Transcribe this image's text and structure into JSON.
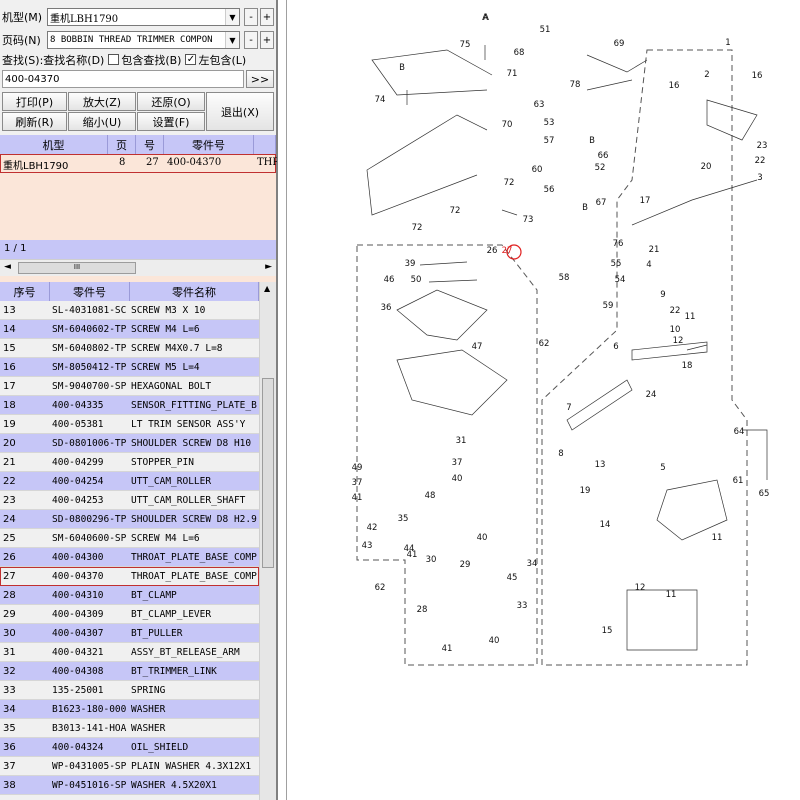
{
  "top": {
    "model_label": "机型(M)",
    "model_value": "重机LBH1790",
    "page_label": "页码(N)",
    "page_value": "8 BOBBIN THREAD TRIMMER COMPON",
    "search_label": "查找(S):",
    "search_name_label": "查找名称(D)",
    "include_search_label": "包含查找(B)",
    "left_include_label": "左包含(L)",
    "include_search_checked": false,
    "left_include_checked": true,
    "search_value": "400-04370",
    "go_label": ">>",
    "minus": "-",
    "plus": "+"
  },
  "buttons": {
    "print": "打印(P)",
    "zoom_in": "放大(Z)",
    "restore": "还原(O)",
    "exit": "退出(X)",
    "refresh": "刷新(R)",
    "zoom_out": "缩小(U)",
    "settings": "设置(F)"
  },
  "result_table": {
    "headers": [
      "机型",
      "页",
      "号",
      "零件号",
      ""
    ],
    "row": [
      "重机LBH1790",
      "8",
      "27",
      "400-04370",
      "THR"
    ],
    "pager": "1 / 1",
    "hscroll_thumb": "III"
  },
  "parts_table": {
    "headers": [
      "序号",
      "零件号",
      "零件名称"
    ],
    "selected_index": 27,
    "rows": [
      [
        "13",
        "SL-4031081-SC",
        "SCREW M3 X 10"
      ],
      [
        "14",
        "SM-6040602-TP",
        "SCREW M4 L=6"
      ],
      [
        "15",
        "SM-6040802-TP",
        "SCREW M4X0.7 L=8"
      ],
      [
        "16",
        "SM-8050412-TP",
        "SCREW M5 L=4"
      ],
      [
        "17",
        "SM-9040700-SP",
        "HEXAGONAL BOLT"
      ],
      [
        "18",
        "400-04335",
        "SENSOR_FITTING_PLATE_B"
      ],
      [
        "19",
        "400-05381",
        "LT TRIM SENSOR ASS'Y"
      ],
      [
        "20",
        "SD-0801006-TP",
        "SHOULDER SCREW D8 H10"
      ],
      [
        "21",
        "400-04299",
        "STOPPER_PIN"
      ],
      [
        "22",
        "400-04254",
        "UTT_CAM_ROLLER"
      ],
      [
        "23",
        "400-04253",
        "UTT_CAM_ROLLER_SHAFT"
      ],
      [
        "24",
        "SD-0800296-TP",
        "SHOULDER SCREW D8 H2.9"
      ],
      [
        "25",
        "SM-6040600-SP",
        "SCREW M4 L=6"
      ],
      [
        "26",
        "400-04300",
        "THROAT_PLATE_BASE_COMP"
      ],
      [
        "27",
        "400-04370",
        "THROAT_PLATE_BASE_COMP"
      ],
      [
        "28",
        "400-04310",
        "BT_CLAMP"
      ],
      [
        "29",
        "400-04309",
        "BT_CLAMP_LEVER"
      ],
      [
        "30",
        "400-04307",
        "BT_PULLER"
      ],
      [
        "31",
        "400-04321",
        "ASSY_BT_RELEASE_ARM"
      ],
      [
        "32",
        "400-04308",
        "BT_TRIMMER_LINK"
      ],
      [
        "33",
        "135-25001",
        "SPRING"
      ],
      [
        "34",
        "B1623-180-000",
        "WASHER"
      ],
      [
        "35",
        "B3013-141-HOA",
        "WASHER"
      ],
      [
        "36",
        "400-04324",
        "OIL_SHIELD"
      ],
      [
        "37",
        "WP-0431005-SP",
        "PLAIN WASHER 4.3X12X1"
      ],
      [
        "38",
        "WP-0451016-SP",
        "WASHER 4.5X20X1"
      ]
    ]
  },
  "diagram": {
    "labels": [
      "A",
      "75",
      "B",
      "74",
      "71",
      "70",
      "72",
      "72",
      "72",
      "B",
      "73",
      "26",
      "27",
      "39",
      "46",
      "50",
      "36",
      "47",
      "62",
      "49",
      "37",
      "41",
      "31",
      "37",
      "40",
      "41",
      "48",
      "35",
      "42",
      "43",
      "44",
      "40",
      "30",
      "29",
      "34",
      "45",
      "33",
      "28",
      "41",
      "40",
      "62",
      "51",
      "69",
      "68",
      "78",
      "63",
      "53",
      "57",
      "60",
      "56",
      "52",
      "66",
      "67",
      "B",
      "76",
      "55",
      "58",
      "54",
      "59",
      "1",
      "16",
      "2",
      "16",
      "23",
      "22",
      "20",
      "3",
      "17",
      "21",
      "4",
      "9",
      "11",
      "10",
      "22",
      "12",
      "6",
      "18",
      "24",
      "7",
      "8",
      "13",
      "19",
      "14",
      "5",
      "64",
      "61",
      "65",
      "11",
      "12",
      "15",
      "11",
      "A"
    ],
    "highlight": "27"
  }
}
